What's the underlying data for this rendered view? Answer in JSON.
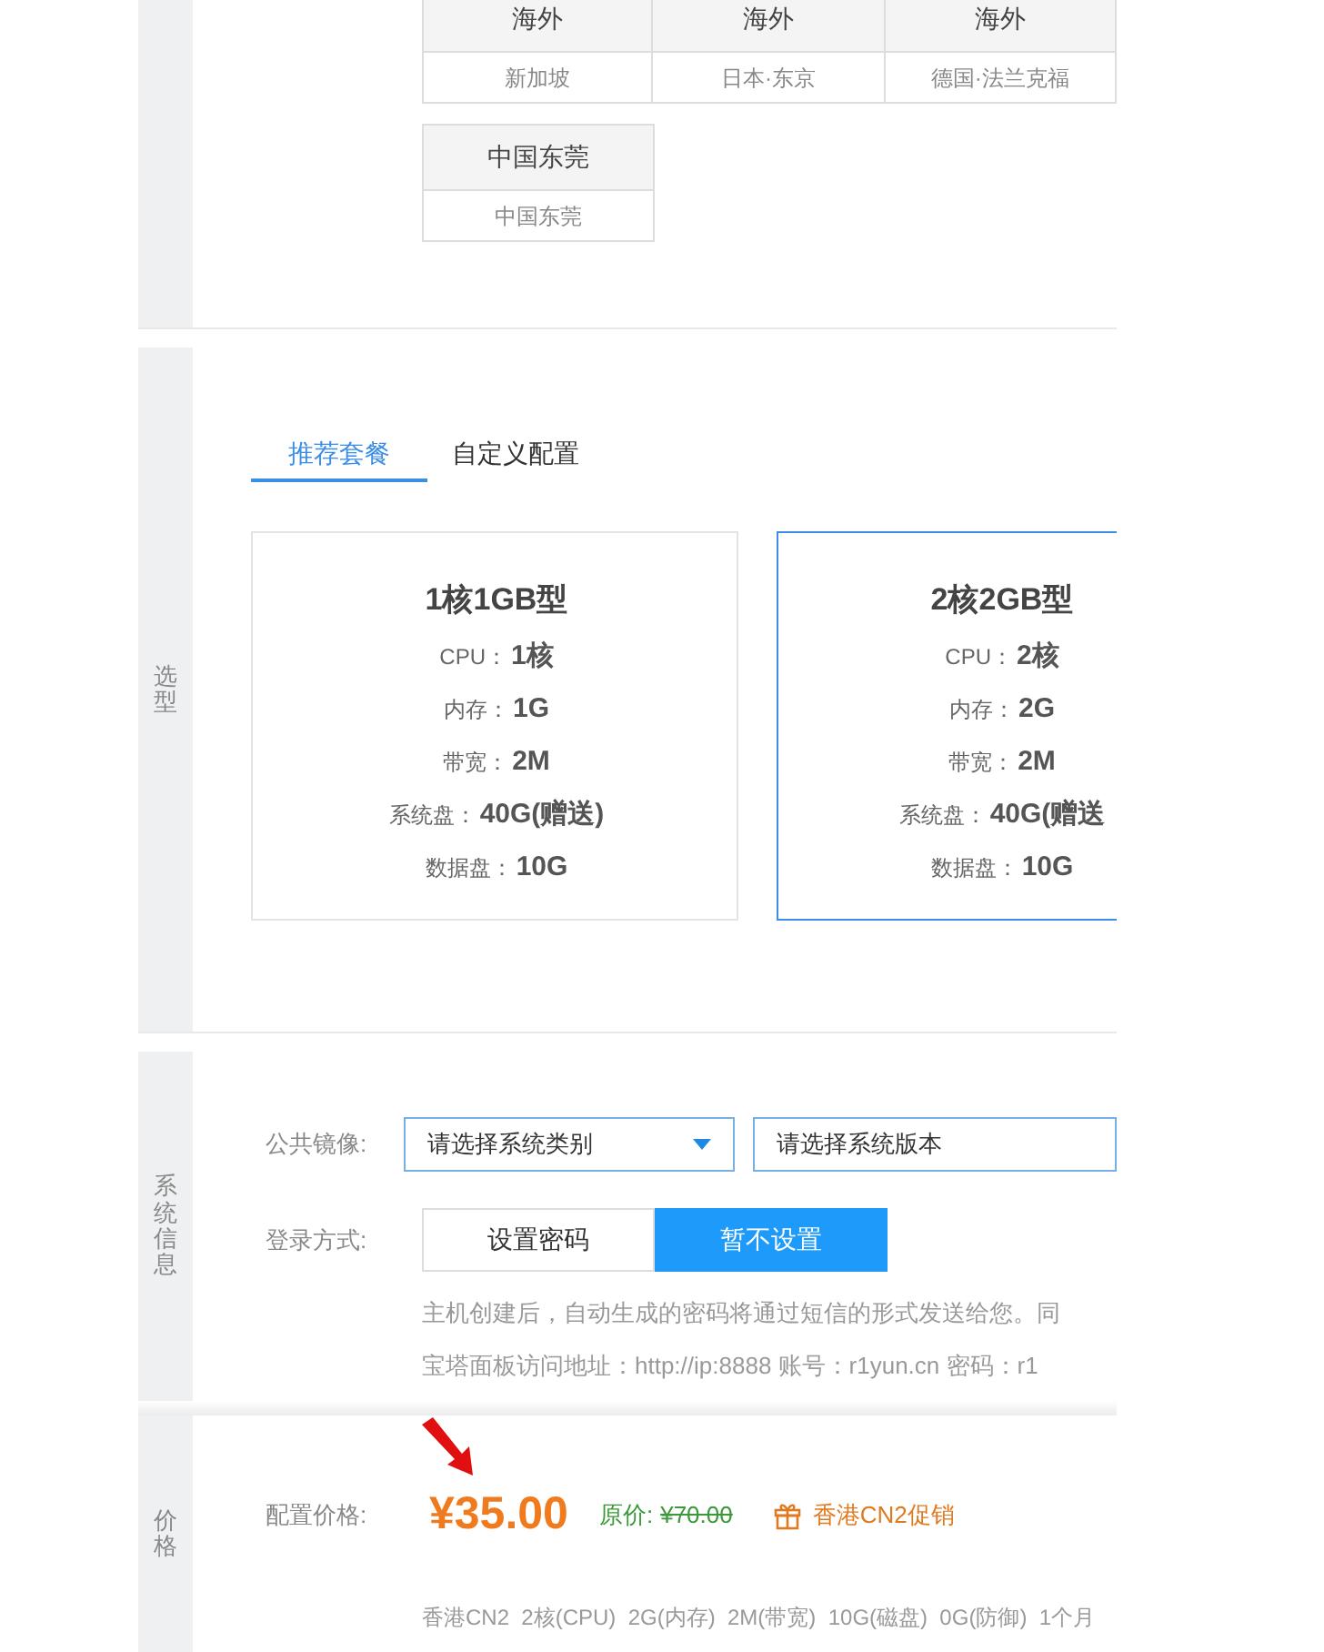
{
  "region_section": {
    "tables": [
      {
        "cells": [
          {
            "header": "海外",
            "name": "新加坡"
          },
          {
            "header": "海外",
            "name": "日本·东京"
          },
          {
            "header": "海外",
            "name": "德国·法兰克福"
          }
        ]
      },
      {
        "cells": [
          {
            "header": "中国东莞",
            "name": "中国东莞"
          }
        ]
      }
    ]
  },
  "model_section": {
    "label": "选型",
    "tabs": [
      {
        "label": "推荐套餐",
        "selected": true
      },
      {
        "label": "自定义配置",
        "selected": false
      }
    ],
    "plans": [
      {
        "title": "1核1GB型",
        "selected": false,
        "specs": [
          {
            "key": "CPU：",
            "value": "1核"
          },
          {
            "key": "内存：",
            "value": "1G"
          },
          {
            "key": "带宽：",
            "value": "2M"
          },
          {
            "key": "系统盘：",
            "value": "40G(赠送)"
          },
          {
            "key": "数据盘：",
            "value": "10G"
          }
        ]
      },
      {
        "title": "2核2GB型",
        "selected": true,
        "specs": [
          {
            "key": "CPU：",
            "value": "2核"
          },
          {
            "key": "内存：",
            "value": "2G"
          },
          {
            "key": "带宽：",
            "value": "2M"
          },
          {
            "key": "系统盘：",
            "value": "40G(赠送"
          },
          {
            "key": "数据盘：",
            "value": "10G"
          }
        ]
      }
    ]
  },
  "system_section": {
    "label": "系统信息",
    "image_label": "公共镜像:",
    "image_selects": [
      {
        "placeholder": "请选择系统类别",
        "dropdown": true
      },
      {
        "placeholder": "请选择系统版本",
        "dropdown": false
      }
    ],
    "login_label": "登录方式:",
    "login_options": [
      {
        "label": "设置密码",
        "selected": false
      },
      {
        "label": "暂不设置",
        "selected": true
      }
    ],
    "notes": [
      "主机创建后，自动生成的密码将通过短信的形式发送给您。同",
      "宝塔面板访问地址：http://ip:8888 账号：r1yun.cn 密码：r1"
    ]
  },
  "price_section": {
    "label": "价格",
    "price_label": "配置价格:",
    "price": "¥35.00",
    "original_label": "原价:",
    "original_price": "¥70.00",
    "promo": "香港CN2促销",
    "summary": "香港CN2  2核(CPU)  2G(内存)  2M(带宽)  10G(磁盘)  0G(防御)  1个月"
  }
}
